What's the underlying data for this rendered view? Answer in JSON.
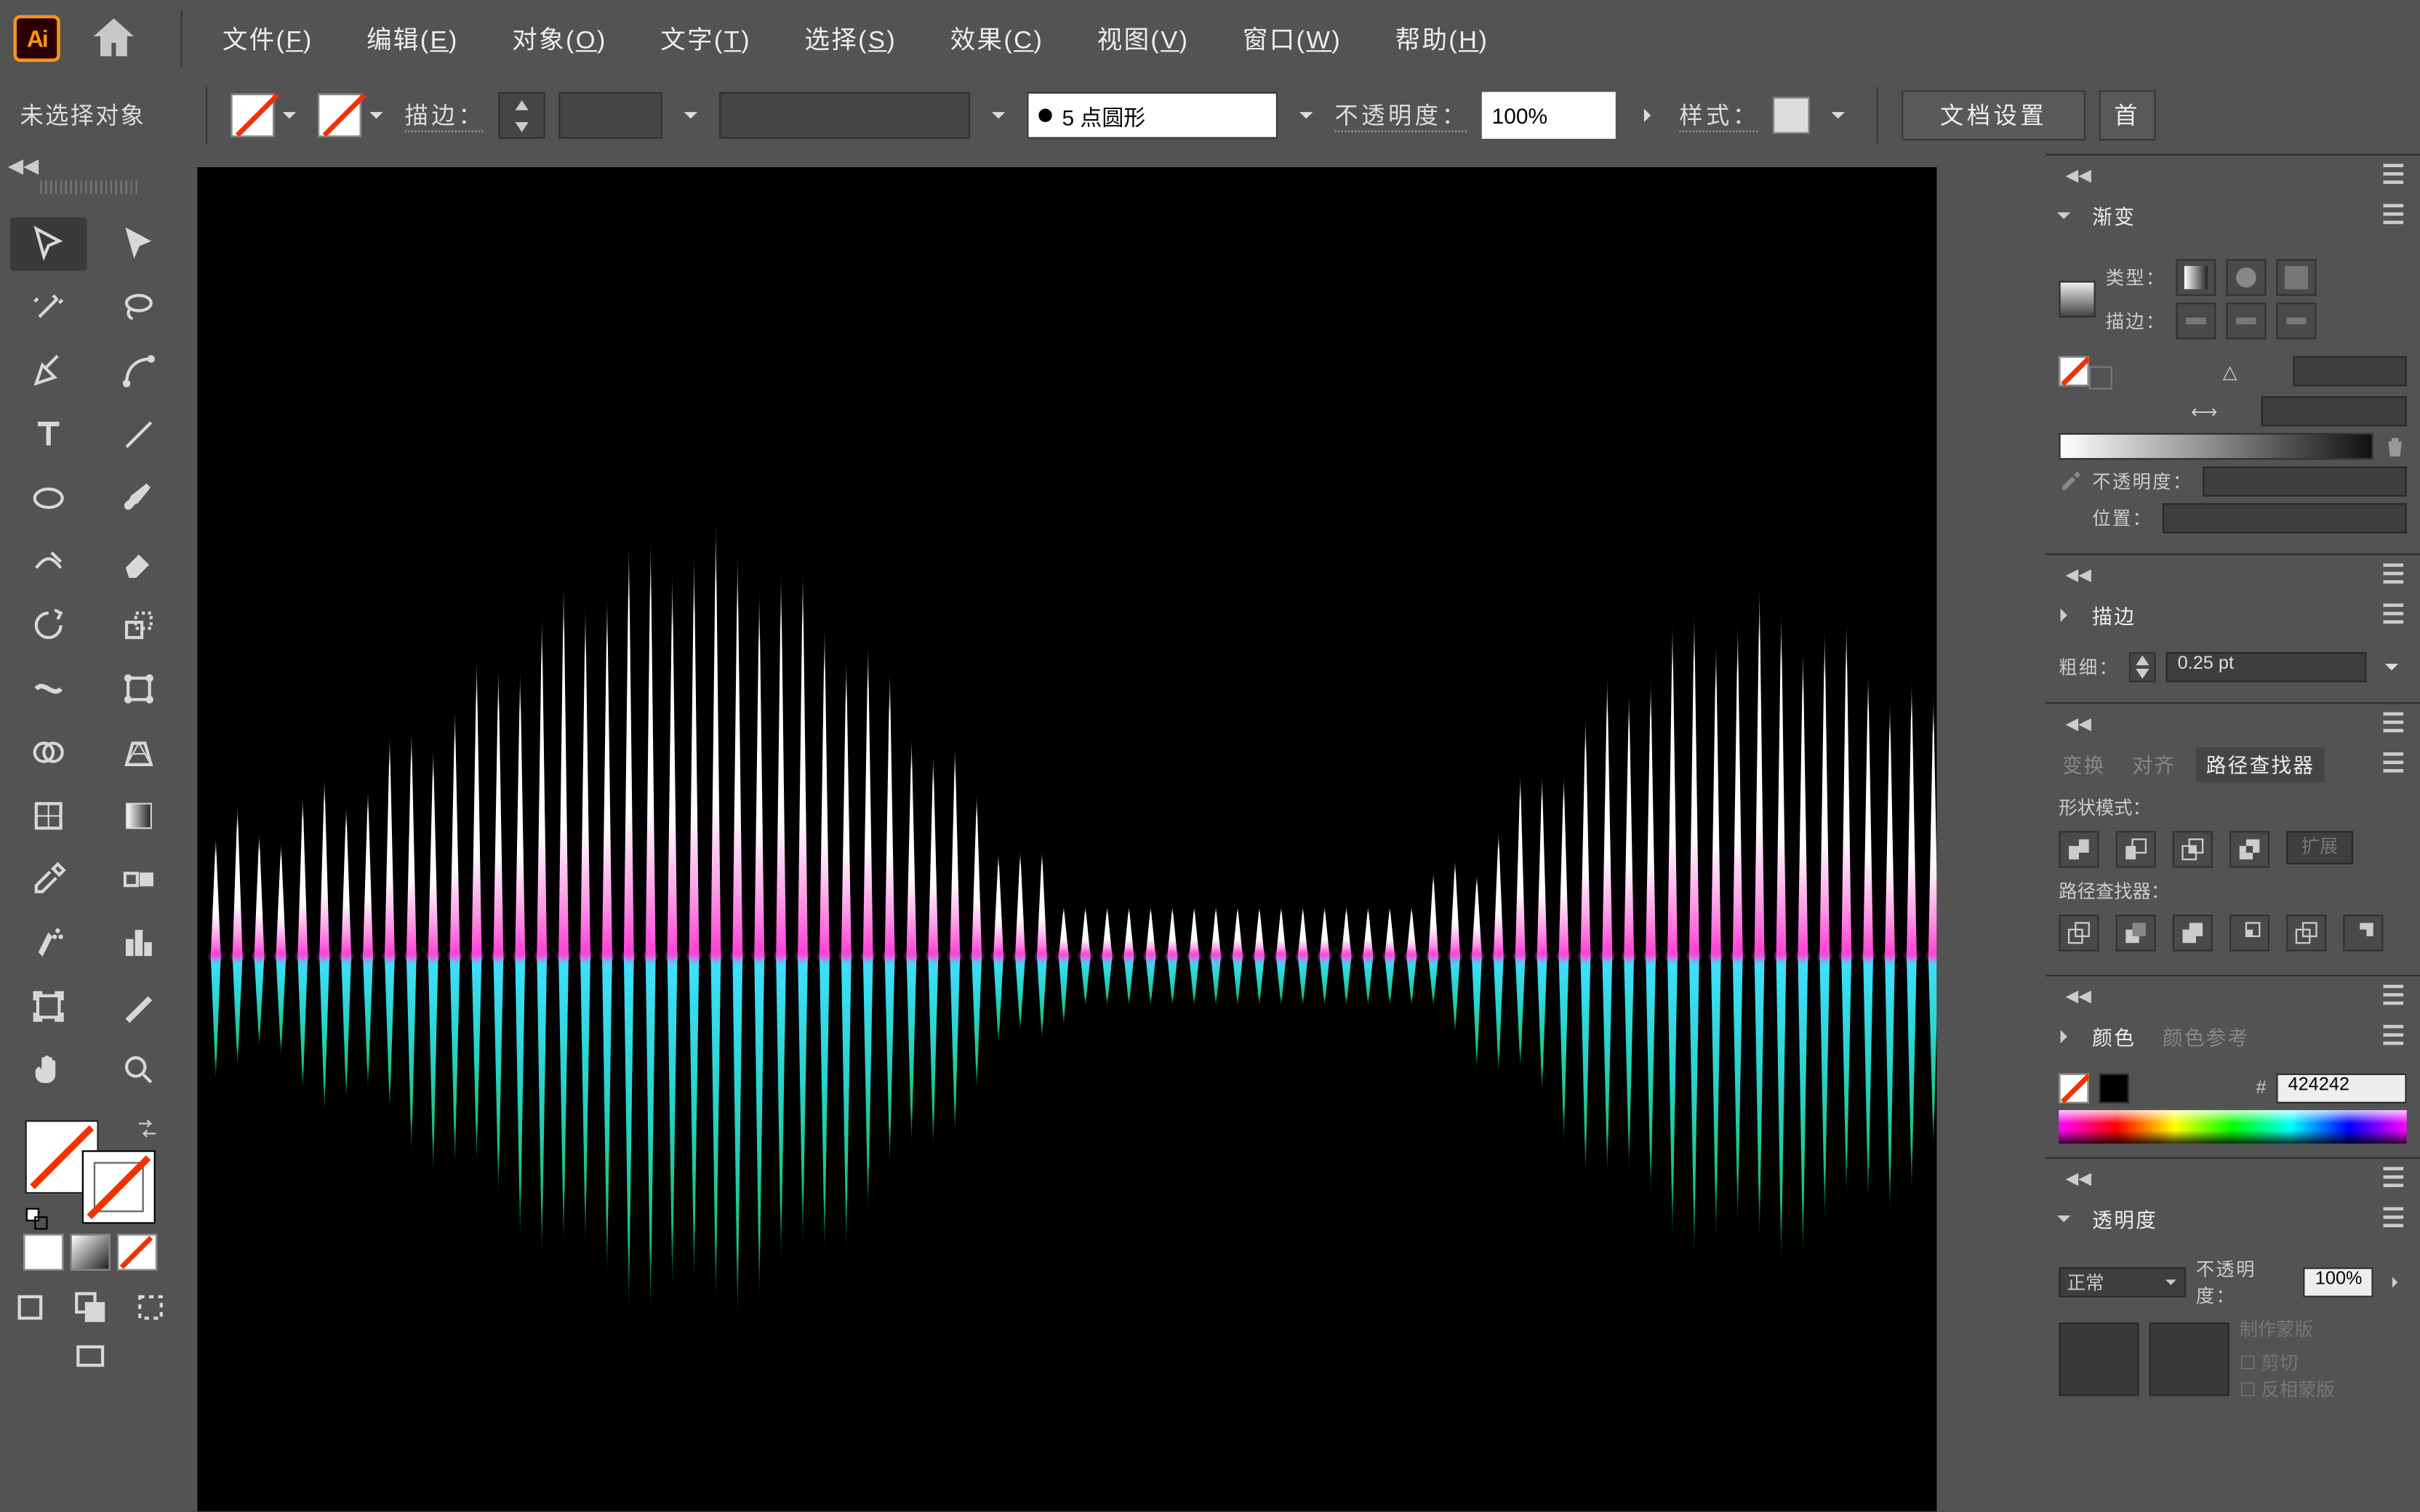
{
  "app_badge": "Ai",
  "menubar": [
    {
      "label": "文件",
      "accel": "F"
    },
    {
      "label": "编辑",
      "accel": "E"
    },
    {
      "label": "对象",
      "accel": "O"
    },
    {
      "label": "文字",
      "accel": "T"
    },
    {
      "label": "选择",
      "accel": "S"
    },
    {
      "label": "效果",
      "accel": "C"
    },
    {
      "label": "视图",
      "accel": "V"
    },
    {
      "label": "窗口",
      "accel": "W"
    },
    {
      "label": "帮助",
      "accel": "H"
    }
  ],
  "ctrlbar": {
    "selection": "未选择对象",
    "stroke_label": "描边：",
    "cap_value": "5 点圆形",
    "opacity_label": "不透明度：",
    "opacity_value": "100%",
    "style_label": "样式：",
    "doc_setup": "文档设置",
    "pref": "首"
  },
  "panels": {
    "gradient": {
      "tab": "渐变",
      "type_label": "类型：",
      "stroke_label": "描边：",
      "angle_label": "△",
      "ratio_label": "⟷",
      "opacity_label": "不透明度：",
      "location_label": "位置："
    },
    "stroke": {
      "tab": "描边",
      "weight_label": "粗细：",
      "weight_value": "0.25 pt"
    },
    "pathfinder": {
      "tabs": [
        "变换",
        "对齐",
        "路径查找器"
      ],
      "shape_modes": "形状模式：",
      "expand": "扩展",
      "pathfinders": "路径查找器："
    },
    "color": {
      "tabs": [
        "颜色",
        "颜色参考"
      ],
      "hex_label": "#",
      "hex_value": "424242"
    },
    "transparency": {
      "tab": "透明度",
      "blend": "正常",
      "opacity_label": "不透明度：",
      "opacity_value": "100%",
      "make_mask": "制作蒙版",
      "clip": "剪切",
      "invert": "反相蒙版"
    }
  },
  "tools": [
    "selection",
    "direct-selection",
    "magic-wand",
    "lasso",
    "pen",
    "curvature",
    "type",
    "line",
    "ellipse",
    "brush",
    "shaper",
    "eraser",
    "rotate",
    "scale",
    "width",
    "free-transform",
    "shape-builder",
    "perspective",
    "mesh",
    "gradient",
    "eyedropper",
    "blend",
    "symbol-sprayer",
    "column-graph",
    "artboard",
    "slice",
    "hand",
    "zoom"
  ]
}
